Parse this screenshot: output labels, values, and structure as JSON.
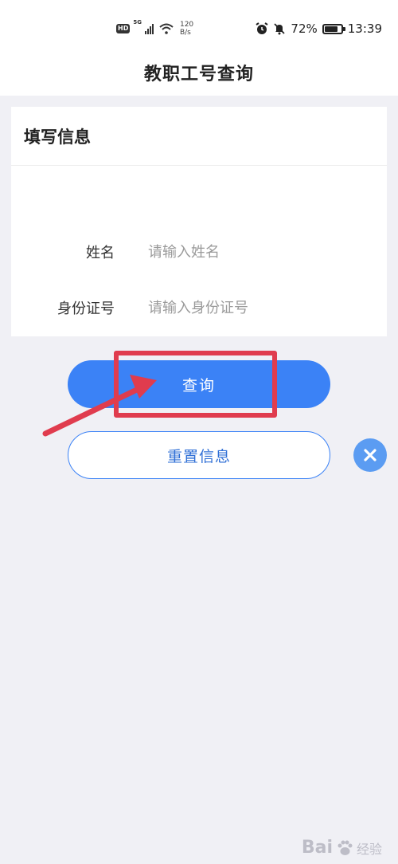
{
  "status_bar": {
    "hd_badge": "HD",
    "signal_label": "5G",
    "net_speed_value": "120",
    "net_speed_unit": "B/s",
    "battery_percent": "72%",
    "battery_level": 0.72,
    "time": "13:39"
  },
  "header": {
    "title": "教职工号查询"
  },
  "card": {
    "title": "填写信息",
    "fields": [
      {
        "label": "姓名",
        "placeholder": "请输入姓名"
      },
      {
        "label": "身份证号",
        "placeholder": "请输入身份证号"
      }
    ]
  },
  "actions": {
    "query_label": "查询",
    "reset_label": "重置信息"
  },
  "colors": {
    "accent": "#3b82f6",
    "annotation": "#e03c4e",
    "background": "#f0f0f5"
  },
  "watermark": {
    "brand": "Bai",
    "sub": "经验"
  }
}
